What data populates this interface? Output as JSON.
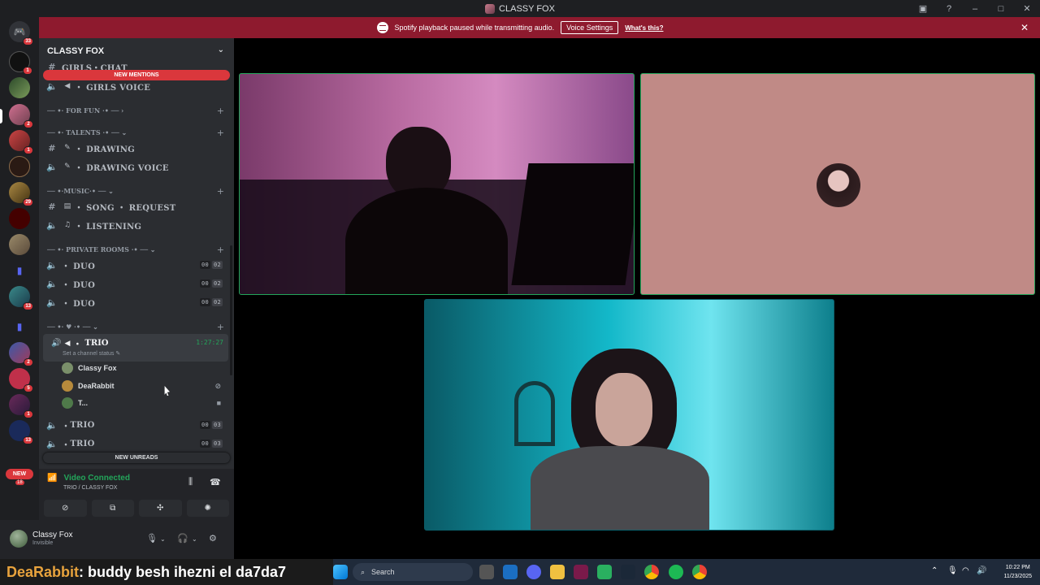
{
  "window": {
    "title": "CLASSY FOX"
  },
  "notice": {
    "text": "Spotify playback paused while transmitting audio.",
    "button": "Voice Settings",
    "link": "What's this?"
  },
  "servers": {
    "home_badge": "33",
    "badges": [
      "1",
      "2",
      "1",
      "29",
      "13",
      "2",
      "5",
      "1",
      "13"
    ],
    "new_label": "NEW",
    "new_count": "18"
  },
  "sidebar": {
    "server_name": "CLASSY FOX",
    "new_mentions": "NEW MENTIONS",
    "new_unreads": "NEW UNREADS",
    "partial_channel": "GIRLS・CHAT",
    "channels": [
      {
        "name": "・ GIRLS VOICE"
      },
      {
        "category": "── •· FOR FUN ·• ── ›"
      },
      {
        "category": "── •· TALENTS ·• ── ⌄"
      },
      {
        "name": "・ DRAWING"
      },
      {
        "name": "・ DRAWING VOICE"
      },
      {
        "category": "── •·MUSIC·• ── ⌄"
      },
      {
        "name": "・ SONG ・ REQUEST"
      },
      {
        "name": "・ LISTENING"
      },
      {
        "category": "── •· PRIVATE ROOMS ·• ── ⌄"
      },
      {
        "name": "・ DUO",
        "a": "00",
        "b": "02"
      },
      {
        "name": "・ DUO",
        "a": "00",
        "b": "02"
      },
      {
        "name": "・ DUO",
        "a": "00",
        "b": "02"
      },
      {
        "category": "── •· ♥ ·• ── ⌄"
      }
    ],
    "active": {
      "name": "TRIO",
      "timer": "1:27:27",
      "status": "Set a channel status ✎"
    },
    "members": [
      {
        "name": "Classy Fox",
        "color": "#7a8f6a"
      },
      {
        "name": "DeaRabbit",
        "color": "#b78a3c"
      },
      {
        "name": "T...",
        "color": "#4f7a4a"
      }
    ],
    "more_trio": [
      {
        "name": "TRIO",
        "a": "00",
        "b": "03"
      },
      {
        "name": "TRIO",
        "a": "00",
        "b": "03"
      }
    ]
  },
  "rtc": {
    "status": "Video Connected",
    "location": "TRIO / CLASSY FOX"
  },
  "user": {
    "name": "Classy Fox",
    "status": "Invisible"
  },
  "caption": {
    "speaker": "DeaRabbit",
    "text": " : buddy besh ihezni el da7da7"
  },
  "taskbar": {
    "search": "Search",
    "time": "10:22 PM",
    "date": "11/23/2025"
  }
}
